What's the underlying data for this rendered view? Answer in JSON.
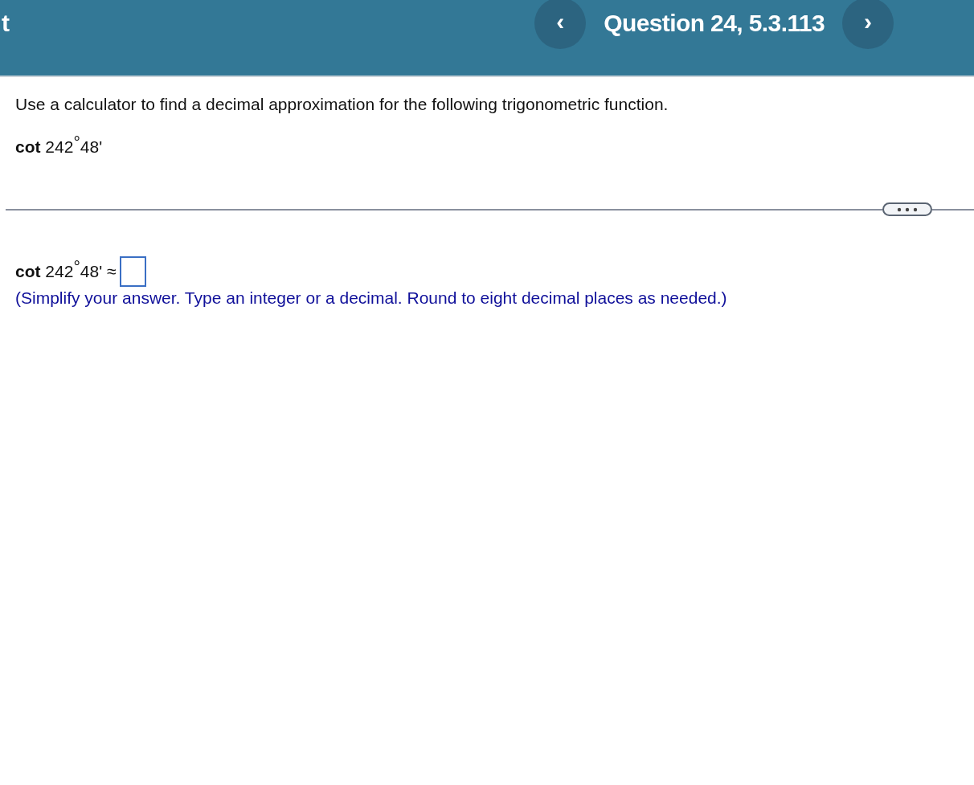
{
  "header": {
    "cut_title": "t",
    "prev_button": "‹",
    "title": "Question 24, 5.3.113",
    "next_button": "›"
  },
  "question": {
    "instruction": "Use a calculator to find a decimal approximation for the following trigonometric function.",
    "expression": "**cot** 242$^{°}$48'"
  },
  "answer": {
    "prompt": "**cot** 242$^{°}$48' ≈",
    "hint": "(Simplify your answer. Type an integer or a decimal. Round to eight decimal places as needed.)"
  }
}
